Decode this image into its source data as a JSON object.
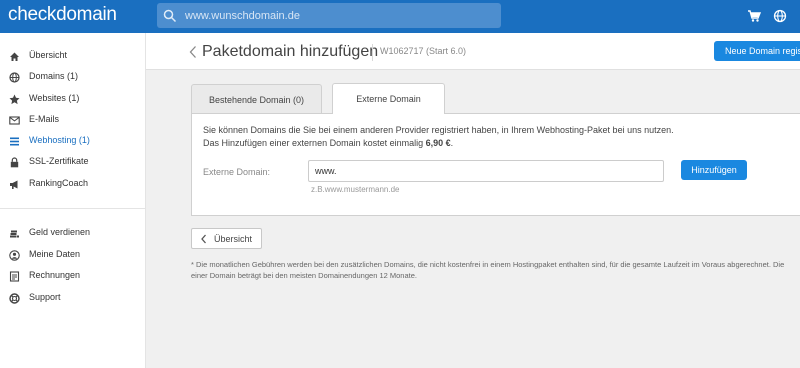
{
  "app": {
    "logo_text": "checkdomain"
  },
  "search": {
    "placeholder": "www.wunschdomain.de"
  },
  "topbar_icons": [
    "cart-icon",
    "globe-icon"
  ],
  "sidebar": {
    "items": [
      {
        "label": "Übersicht",
        "icon": "home-icon"
      },
      {
        "label": "Domains (1)",
        "icon": "globe-icon"
      },
      {
        "label": "Websites (1)",
        "icon": "star-icon"
      },
      {
        "label": "E-Mails",
        "icon": "envelope-icon"
      },
      {
        "label": "Webhosting (1)",
        "icon": "list-icon",
        "active": true
      },
      {
        "label": "SSL-Zertifikate",
        "icon": "lock-icon"
      },
      {
        "label": "RankingCoach",
        "icon": "megaphone-icon"
      }
    ],
    "items2": [
      {
        "label": "Geld verdienen",
        "icon": "coins-icon"
      },
      {
        "label": "Meine Daten",
        "icon": "user-icon"
      },
      {
        "label": "Rechnungen",
        "icon": "invoice-icon"
      },
      {
        "label": "Support",
        "icon": "lifebuoy-icon"
      }
    ]
  },
  "header": {
    "title": "Paketdomain hinzufügen",
    "subtitle": "W1062717 (Start 6.0)",
    "new_domain_button": "Neue Domain registrieren"
  },
  "tabs": [
    {
      "label": "Bestehende Domain (0)",
      "active": false
    },
    {
      "label": "Externe Domain",
      "active": true
    }
  ],
  "panel": {
    "info_line1": "Sie können Domains die Sie bei einem anderen Provider registriert haben, in Ihrem Webhosting-Paket bei uns nutzen.",
    "info_line2_prefix": "Das Hinzufügen einer externen Domain kostet einmalig ",
    "info_line2_price": "6,90 €",
    "info_line2_suffix": ".",
    "field_label": "Externe Domain:",
    "field_value": "www.",
    "field_hint": "z.B.www.mustermann.de",
    "add_button": "Hinzufügen"
  },
  "overview_button": "Übersicht",
  "footnote": {
    "line1": "* Die monatlichen Gebühren werden bei den zusätzlichen Domains, die nicht kostenfrei in einem Hostingpaket enthalten sind, für die gesamte Laufzeit im Voraus abgerechnet. Die",
    "line2": "einer Domain beträgt bei den meisten Domainendungen 12 Monate."
  },
  "colors": {
    "topbar": "#1a6fc0",
    "accent": "#1a88e0",
    "active_nav": "#1a6fc0",
    "background": "#f0f0f0"
  }
}
